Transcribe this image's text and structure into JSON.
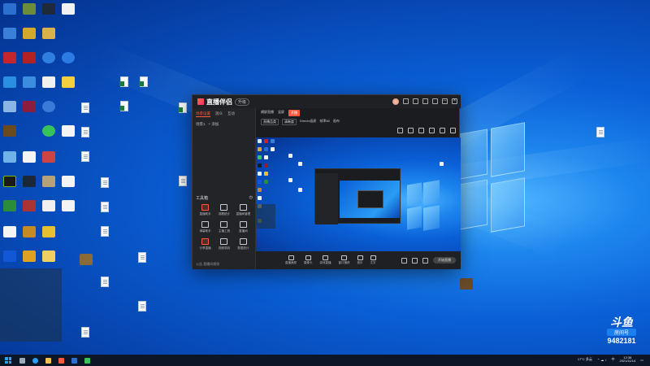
{
  "desktop": {
    "wallpaper": "windows-10-hero-blue"
  },
  "app": {
    "logo_text": "直播伴侣",
    "version_badge": "升级",
    "side_tabs": [
      "场景设置",
      "观众",
      "互动"
    ],
    "side_row": [
      "场景1",
      "+ 添加"
    ],
    "tools_section_title": "工具箱",
    "tools": [
      {
        "label": "直播助手",
        "icon": "gift-icon"
      },
      {
        "label": "观看统计",
        "icon": "chart-icon"
      },
      {
        "label": "直播间管理",
        "icon": "calendar-icon"
      },
      {
        "label": "弹幕助手",
        "icon": "chat-icon"
      },
      {
        "label": "主播工具",
        "icon": "tool-icon"
      },
      {
        "label": "直播间",
        "icon": "home-icon"
      },
      {
        "label": "分享直播",
        "icon": "share-icon"
      },
      {
        "label": "视频录制",
        "icon": "record-icon"
      },
      {
        "label": "数据统计",
        "icon": "data-icon"
      }
    ],
    "side_footer": "公告 直播间规则",
    "main_tabs": [
      "横屏直播",
      "竖屏"
    ],
    "main_chips": [
      "直播品类",
      "清晰度",
      "Directx画质",
      "帧率60",
      "画布"
    ],
    "live_chip": "开播",
    "bottom_controls": [
      "直播美颜",
      "摄像头",
      "游戏直播",
      "窗口捕获",
      "音乐",
      "文字"
    ],
    "start_button": "开始直播"
  },
  "taskbar": {
    "weather": "17°C 多云",
    "time": "12:38",
    "date": "2021/11/14",
    "lang": "中"
  },
  "watermark": {
    "logo": "斗鱼",
    "room_label": "房间号",
    "room_number": "9482181"
  }
}
